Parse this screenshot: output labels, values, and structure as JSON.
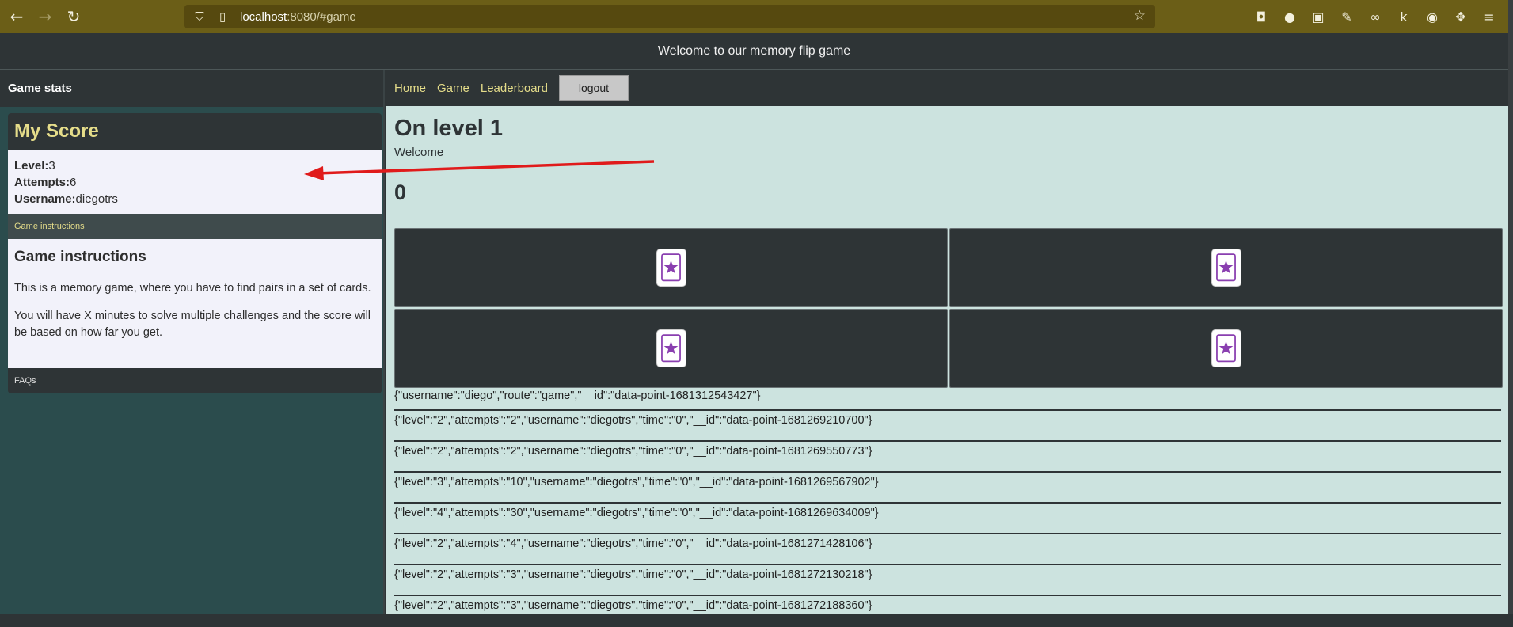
{
  "browser": {
    "url_host": "localhost",
    "url_rest": ":8080/#game"
  },
  "app": {
    "header": "Welcome to our memory flip game"
  },
  "sidebar": {
    "title": "Game stats",
    "score": {
      "heading": "My Score",
      "level_label": "Level:",
      "level_value": "3",
      "attempts_label": "Attempts:",
      "attempts_value": "6",
      "username_label": "Username:",
      "username_value": "diegotrs"
    },
    "instructions": {
      "tab": "Game instructions",
      "title": "Game instructions",
      "p1": "This is a memory game, where you have to find pairs in a set of cards.",
      "p2": "You will have X minutes to solve multiple challenges and the score will be based on how far you get."
    },
    "faq": "FAQs"
  },
  "main": {
    "nav": [
      "Home",
      "Game",
      "Leaderboard"
    ],
    "logout": "logout",
    "level_title": "On level 1",
    "welcome": "Welcome",
    "score": "0",
    "cards": [
      "joker-card",
      "joker-card",
      "joker-card",
      "joker-card"
    ],
    "records": [
      "{\"username\":\"diego\",\"route\":\"game\",\"__id\":\"data-point-1681312543427\"}",
      "{\"level\":\"2\",\"attempts\":\"2\",\"username\":\"diegotrs\",\"time\":\"0\",\"__id\":\"data-point-1681269210700\"}",
      "{\"level\":\"2\",\"attempts\":\"2\",\"username\":\"diegotrs\",\"time\":\"0\",\"__id\":\"data-point-1681269550773\"}",
      "{\"level\":\"3\",\"attempts\":\"10\",\"username\":\"diegotrs\",\"time\":\"0\",\"__id\":\"data-point-1681269567902\"}",
      "{\"level\":\"4\",\"attempts\":\"30\",\"username\":\"diegotrs\",\"time\":\"0\",\"__id\":\"data-point-1681269634009\"}",
      "{\"level\":\"2\",\"attempts\":\"4\",\"username\":\"diegotrs\",\"time\":\"0\",\"__id\":\"data-point-1681271428106\"}",
      "{\"level\":\"2\",\"attempts\":\"3\",\"username\":\"diegotrs\",\"time\":\"0\",\"__id\":\"data-point-1681272130218\"}",
      "{\"level\":\"2\",\"attempts\":\"3\",\"username\":\"diegotrs\",\"time\":\"0\",\"__id\":\"data-point-1681272188360\"}"
    ]
  },
  "colors": {
    "accent_yellow": "#e5dd8a",
    "dark_panel": "#2e3436",
    "sidebar_bg": "#2b4c4d",
    "main_bg": "#cce3df",
    "annotation_arrow": "#e01b1b"
  }
}
